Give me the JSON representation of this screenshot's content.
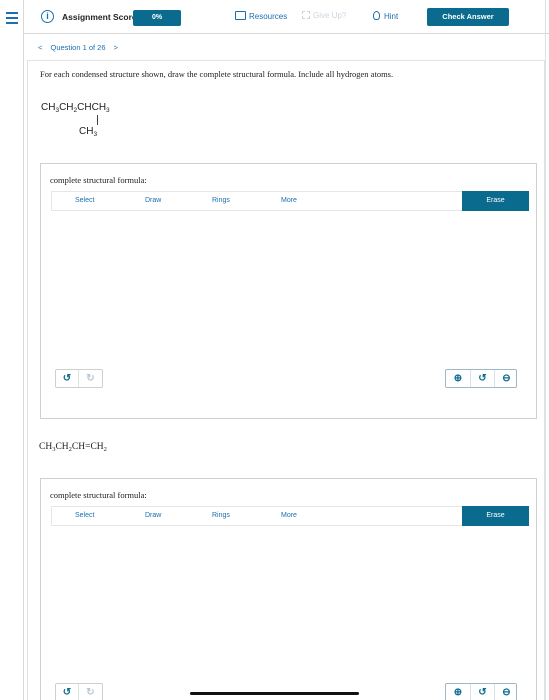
{
  "topbar": {
    "score_label": "Assignment Score:",
    "score_value": "0%",
    "resources_label": "Resources",
    "giveup_label": "Give Up?",
    "hint_label": "Hint",
    "check_label": "Check Answer"
  },
  "question_nav": {
    "prev": "<",
    "label": "Question 1 of 26",
    "next": ">"
  },
  "prompt": "For each condensed structure shown, draw the complete structural formula. Include all hydrogen atoms.",
  "structure1": {
    "main": "CH3CH2CHCH3",
    "branch": "CH3"
  },
  "structure2": "CH3CH2CH=CH2",
  "answers": [
    {
      "label": "complete structural formula:",
      "tools": [
        "Select",
        "Draw",
        "Rings",
        "More"
      ],
      "erase": "Erase"
    },
    {
      "label": "complete structural formula:",
      "tools": [
        "Select",
        "Draw",
        "Rings",
        "More"
      ],
      "erase": "Erase"
    }
  ],
  "icons": {
    "undo": "↺",
    "redo": "↻",
    "zoom_in": "⊕",
    "zoom_reset": "↺",
    "zoom_out": "⊖"
  },
  "colors": {
    "accent": "#0b6b8f",
    "link": "#1a6fb0"
  }
}
